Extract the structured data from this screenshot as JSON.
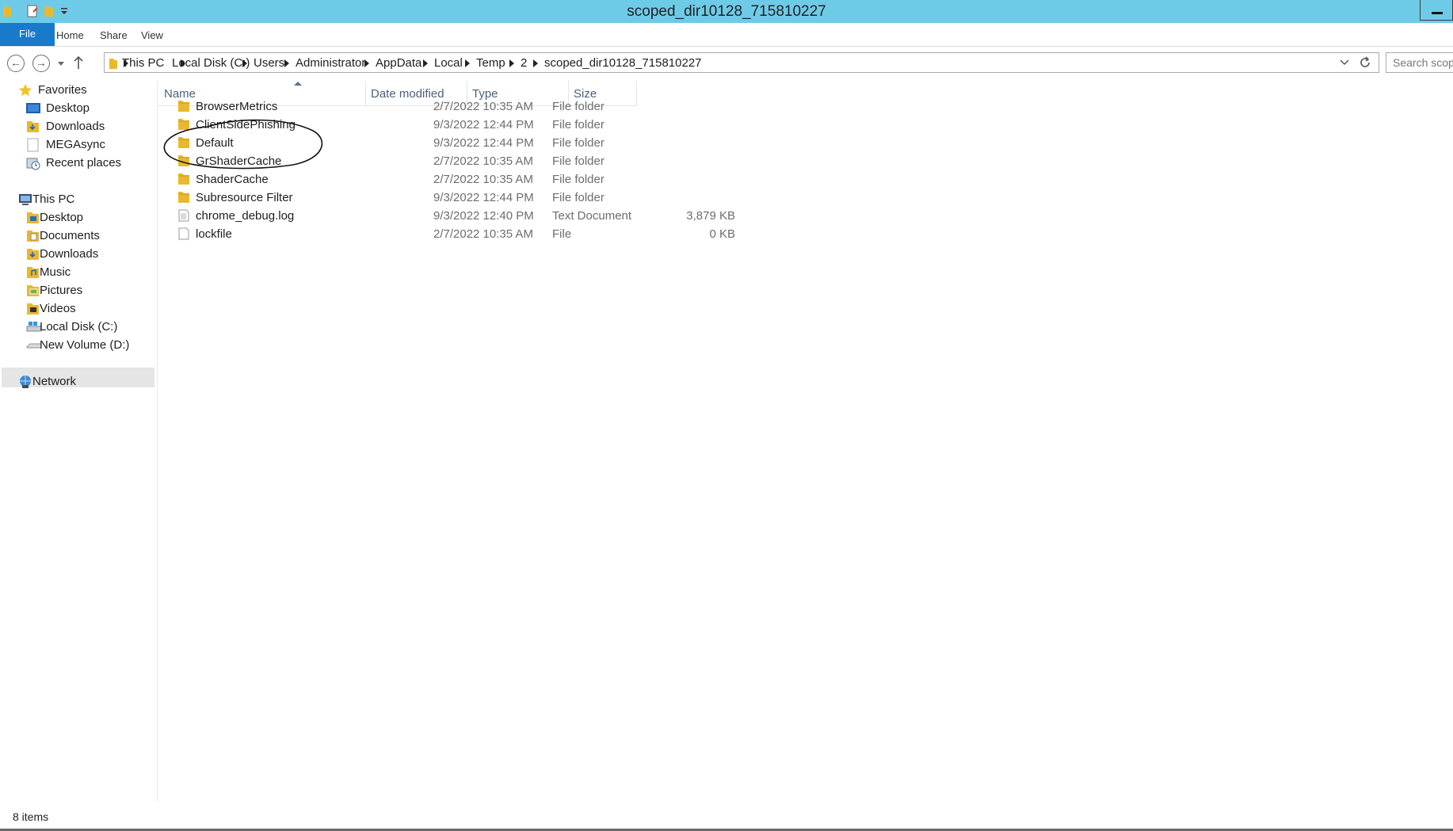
{
  "window": {
    "title": "scoped_dir10128_715810227"
  },
  "ribbon": {
    "tabs": [
      "File",
      "Home",
      "Share",
      "View"
    ]
  },
  "address": {
    "crumbs": [
      "This PC",
      "Local Disk (C:)",
      "Users",
      "Administrator",
      "AppData",
      "Local",
      "Temp",
      "2",
      "scoped_dir10128_715810227"
    ]
  },
  "search": {
    "placeholder": "Search scop"
  },
  "nav": {
    "favorites_label": "Favorites",
    "favorites": [
      "Desktop",
      "Downloads",
      "MEGAsync",
      "Recent places"
    ],
    "thispc_label": "This PC",
    "thispc": [
      "Desktop",
      "Documents",
      "Downloads",
      "Music",
      "Pictures",
      "Videos",
      "Local Disk (C:)",
      "New Volume (D:)"
    ],
    "network_label": "Network",
    "selected": "Local Disk (C:)"
  },
  "columns": {
    "name": "Name",
    "date": "Date modified",
    "type": "Type",
    "size": "Size"
  },
  "files": [
    {
      "name": "BrowserMetrics",
      "date": "2/7/2022 10:35 AM",
      "type": "File folder",
      "size": "",
      "icon": "folder-icon"
    },
    {
      "name": "ClientSidePhishing",
      "date": "9/3/2022 12:44 PM",
      "type": "File folder",
      "size": "",
      "icon": "folder-icon"
    },
    {
      "name": "Default",
      "date": "9/3/2022 12:44 PM",
      "type": "File folder",
      "size": "",
      "icon": "folder-icon"
    },
    {
      "name": "GrShaderCache",
      "date": "2/7/2022 10:35 AM",
      "type": "File folder",
      "size": "",
      "icon": "folder-icon"
    },
    {
      "name": "ShaderCache",
      "date": "2/7/2022 10:35 AM",
      "type": "File folder",
      "size": "",
      "icon": "folder-icon"
    },
    {
      "name": "Subresource Filter",
      "date": "9/3/2022 12:44 PM",
      "type": "File folder",
      "size": "",
      "icon": "folder-icon"
    },
    {
      "name": "chrome_debug.log",
      "date": "9/3/2022 12:40 PM",
      "type": "Text Document",
      "size": "3,879 KB",
      "icon": "text-document-icon"
    },
    {
      "name": "lockfile",
      "date": "2/7/2022 10:35 AM",
      "type": "File",
      "size": "0 KB",
      "icon": "file-icon"
    }
  ],
  "status": {
    "count": "8 items"
  },
  "colors": {
    "titlebar": "#6ecbe8",
    "file_tab": "#1979ca",
    "nav_selected": "#e5e5e5",
    "annotation": "#111111"
  }
}
